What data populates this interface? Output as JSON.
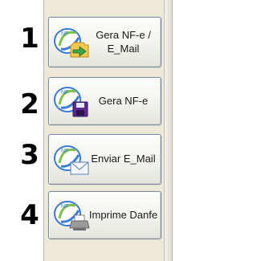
{
  "rows": [
    {
      "number": "1",
      "label_line1": "Gera NF-e /",
      "label_line2": "E_Mail",
      "icon": "nfe-logo-with-arrow-to-folder-icon"
    },
    {
      "number": "2",
      "label_line1": "Gera NF-e",
      "icon": "nfe-logo-with-floppy-disk-icon"
    },
    {
      "number": "3",
      "label_line1": "Enviar E_Mail",
      "icon": "nfe-logo-with-envelope-icon"
    },
    {
      "number": "4",
      "label_line1": "Imprime Danfe",
      "icon": "nfe-logo-with-printer-icon"
    }
  ],
  "colors": {
    "panel": "#ece9d8",
    "button_border": "#7d8fa5",
    "logo_blue": "#3a7bd5",
    "logo_green": "#7cc242"
  }
}
